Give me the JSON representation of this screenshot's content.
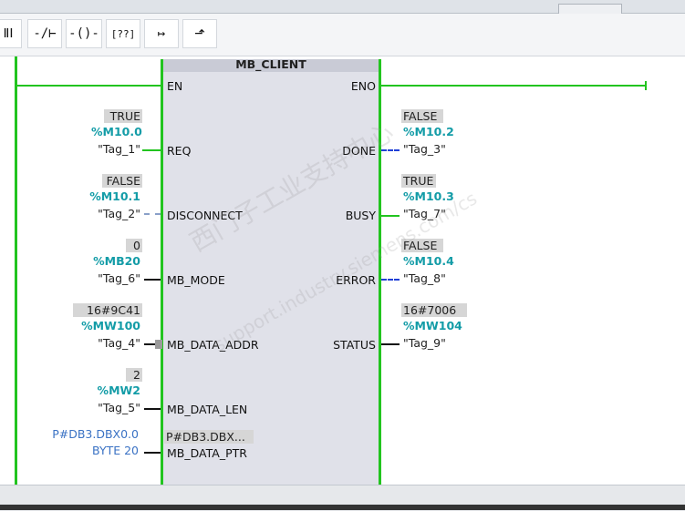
{
  "toolbar": {
    "buttons": [
      {
        "name": "no-contact-button",
        "glyph": "ⅡⅠ"
      },
      {
        "name": "nc-contact-button",
        "glyph": "-/⊢"
      },
      {
        "name": "coil-button",
        "glyph": "-()-"
      },
      {
        "name": "empty-box-button",
        "glyph": "[??]"
      },
      {
        "name": "open-branch-button",
        "glyph": "↦"
      },
      {
        "name": "close-branch-button",
        "glyph": "⬏"
      }
    ]
  },
  "block": {
    "title": "MB_CLIENT",
    "en": "EN",
    "eno": "ENO",
    "inputs": [
      {
        "pin": "REQ",
        "value": "TRUE",
        "address": "%M10.0",
        "tag": "\"Tag_1\""
      },
      {
        "pin": "DISCONNECT",
        "value": "FALSE",
        "address": "%M10.1",
        "tag": "\"Tag_2\""
      },
      {
        "pin": "MB_MODE",
        "value": "0",
        "address": "%MB20",
        "tag": "\"Tag_6\""
      },
      {
        "pin": "MB_DATA_ADDR",
        "value": "16#9C41",
        "address": "%MW100",
        "tag": "\"Tag_4\""
      },
      {
        "pin": "MB_DATA_LEN",
        "value": "2",
        "address": "%MW2",
        "tag": "\"Tag_5\""
      },
      {
        "pin": "MB_DATA_PTR",
        "inner_value": "P#DB3.DBX...",
        "ptr_line1": "P#DB3.DBX0.0",
        "ptr_line2": "BYTE 20"
      }
    ],
    "outputs": [
      {
        "pin": "DONE",
        "value": "FALSE",
        "address": "%M10.2",
        "tag": "\"Tag_3\""
      },
      {
        "pin": "BUSY",
        "value": "TRUE",
        "address": "%M10.3",
        "tag": "\"Tag_7\""
      },
      {
        "pin": "ERROR",
        "value": "FALSE",
        "address": "%M10.4",
        "tag": "\"Tag_8\""
      },
      {
        "pin": "STATUS",
        "value": "16#7006",
        "address": "%MW104",
        "tag": "\"Tag_9\""
      }
    ]
  },
  "watermark": {
    "line1": "西门子工业支持中心",
    "line2": "support.industry.siemens.com/cs"
  },
  "colors": {
    "power_flow": "#22c41f",
    "address": "#139ca7",
    "pointer_text": "#3a72c4",
    "block_body": "#e0e1e9",
    "unpowered_wire": "#1f3fd6"
  }
}
